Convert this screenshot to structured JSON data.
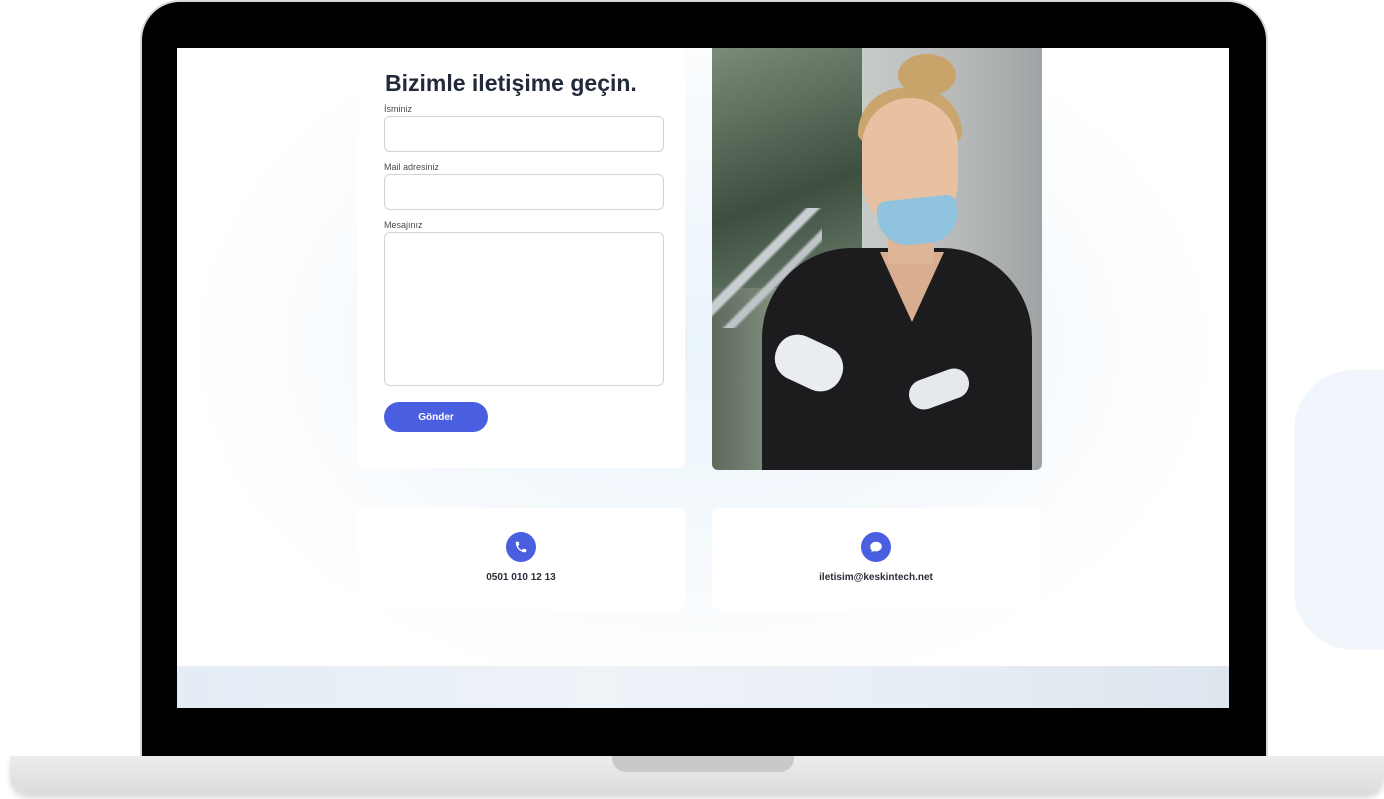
{
  "form": {
    "title": "Bizimle iletişime geçin.",
    "name_label": "İsminiz",
    "email_label": "Mail adresiniz",
    "message_label": "Mesajınız",
    "name_value": "",
    "email_value": "",
    "message_value": "",
    "submit_label": "Gönder"
  },
  "contacts": {
    "phone": {
      "icon": "phone-icon",
      "text": "0501 010 12 13"
    },
    "email": {
      "icon": "chat-bubble-icon",
      "text": "iletisim@keskintech.net"
    }
  },
  "colors": {
    "accent": "#4a5fdf",
    "title": "#222a3a",
    "frame": "#000000"
  }
}
